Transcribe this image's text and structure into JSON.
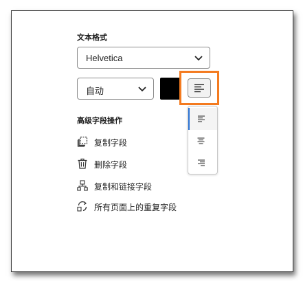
{
  "text_format": {
    "title": "文本格式",
    "font_value": "Helvetica",
    "size_value": "自动",
    "color_value": "#000000"
  },
  "align_menu": {
    "current": "align-left-icon",
    "items": [
      {
        "icon": "align-left-icon",
        "active": true
      },
      {
        "icon": "align-center-icon",
        "active": false
      },
      {
        "icon": "align-right-icon",
        "active": false
      }
    ]
  },
  "advanced": {
    "title": "高级字段操作",
    "actions": [
      {
        "label": "复制字段",
        "icon": "duplicate-icon"
      },
      {
        "label": "删除字段",
        "icon": "trash-icon"
      },
      {
        "label": "复制和链接字段",
        "icon": "copy-link-icon"
      },
      {
        "label": "所有页面上的重复字段",
        "icon": "repeat-pages-icon"
      }
    ]
  },
  "colors": {
    "highlight": "#f47b20",
    "active_indicator": "#2b73d6"
  }
}
